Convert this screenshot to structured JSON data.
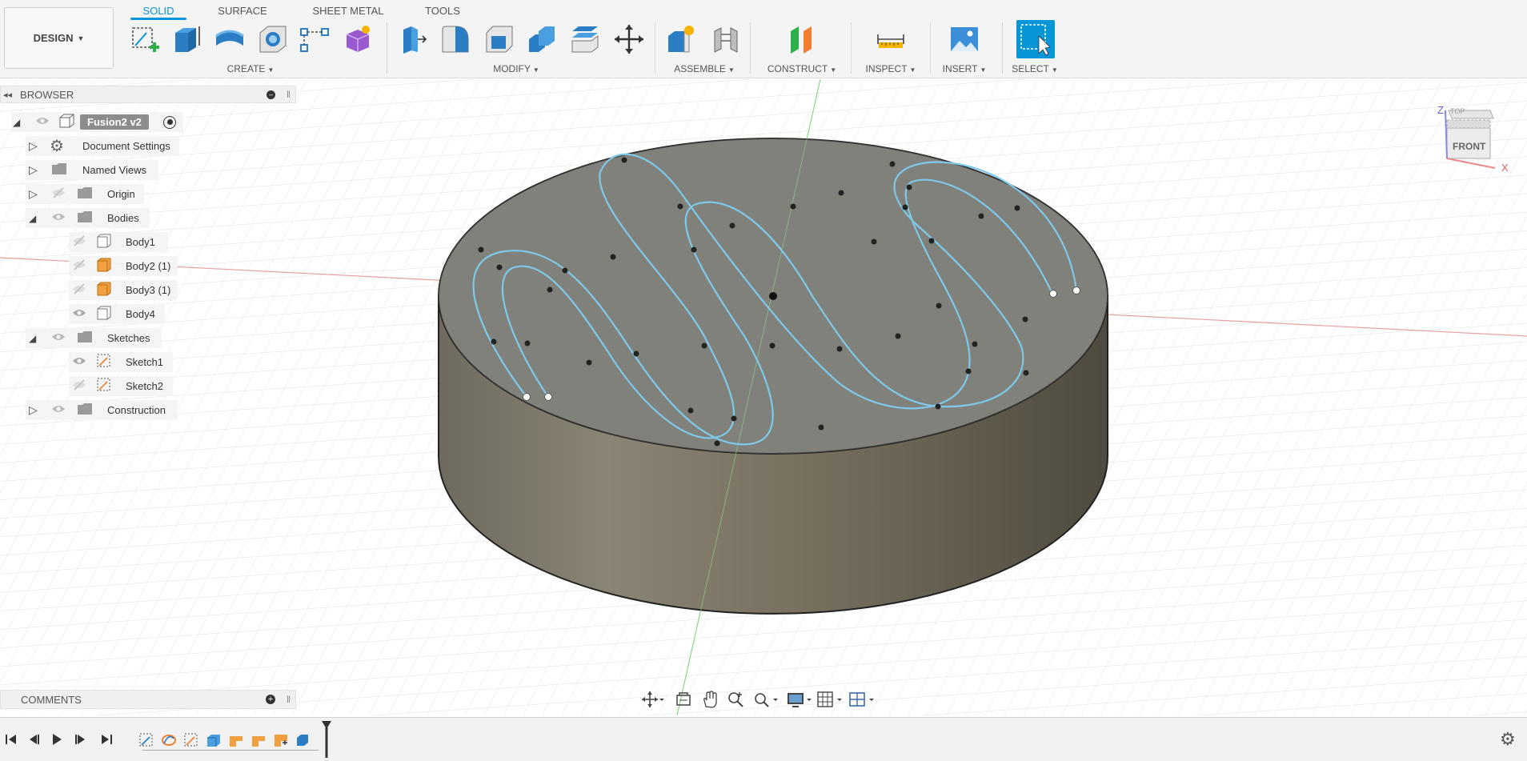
{
  "workspace": {
    "label": "DESIGN"
  },
  "tabs": [
    {
      "label": "SOLID",
      "active": true
    },
    {
      "label": "SURFACE",
      "active": false
    },
    {
      "label": "SHEET METAL",
      "active": false
    },
    {
      "label": "TOOLS",
      "active": false
    }
  ],
  "groups": {
    "create": "CREATE",
    "modify": "MODIFY",
    "assemble": "ASSEMBLE",
    "construct": "CONSTRUCT",
    "inspect": "INSPECT",
    "insert": "INSERT",
    "select": "SELECT"
  },
  "browser": {
    "title": "BROWSER",
    "root": "Fusion2 v2",
    "items": {
      "document_settings": "Document Settings",
      "named_views": "Named Views",
      "origin": "Origin",
      "bodies": "Bodies",
      "body1": "Body1",
      "body2": "Body2 (1)",
      "body3": "Body3 (1)",
      "body4": "Body4",
      "sketches": "Sketches",
      "sketch1": "Sketch1",
      "sketch2": "Sketch2",
      "construction": "Construction"
    }
  },
  "comments": {
    "title": "COMMENTS"
  },
  "viewcube": {
    "top": "TOP",
    "front": "FRONT",
    "axis_x": "X",
    "axis_z": "Z"
  },
  "icons": {
    "tools": [
      "create-sketch-icon",
      "extrude-icon",
      "revolve-icon",
      "hole-icon",
      "rectangular-pattern-icon",
      "create-form-icon",
      "press-pull-icon",
      "fillet-icon",
      "shell-icon",
      "combine-icon",
      "offset-face-icon",
      "move-icon",
      "new-component-icon",
      "joint-icon",
      "offset-plane-icon",
      "measure-icon",
      "insert-image-icon",
      "select-icon"
    ]
  },
  "colors": {
    "accent": "#0696d7",
    "sketch_curve": "#7ec8ea",
    "body_top": "#7a7a72",
    "body_side": "#6d6759",
    "axis_red": "#e08080",
    "axis_green": "#7fd07f",
    "body_orange": "#f0a040"
  }
}
